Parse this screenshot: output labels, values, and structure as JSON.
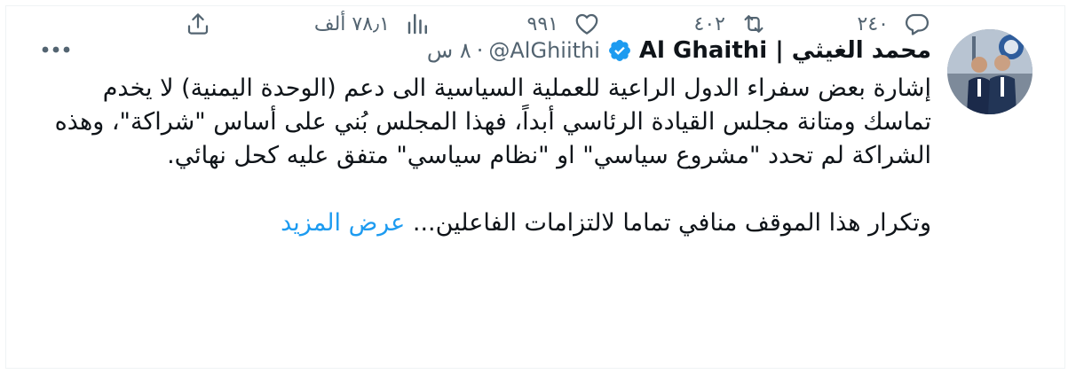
{
  "tweet": {
    "author": {
      "display_name": "محمد الغيثي | Al Ghaithi",
      "handle": "@AlGhiithi",
      "verified": true
    },
    "separator": "·",
    "time": "٨ س",
    "paragraphs": [
      "إشارة بعض سفراء الدول الراعية للعملية السياسية الى دعم (الوحدة اليمنية) لا يخدم تماسك ومتانة مجلس القيادة الرئاسي أبداً، فهذا المجلس بُني على أساس \"شراكة\"، وهذه الشراكة لم تحدد \"مشروع سياسي\" او \"نظام سياسي\" متفق عليه كحل نهائي.",
      "وتكرار هذا الموقف منافي تماما لالتزامات الفاعلين..."
    ],
    "show_more": "عرض المزيد",
    "stats": {
      "replies": "٢٤٠",
      "retweets": "٤٠٢",
      "likes": "٩٩١",
      "views": "٧٨٫١ ألف"
    }
  },
  "icons": {
    "more": "more-horizontal-icon",
    "verified": "verified-badge-icon",
    "reply": "reply-bubble-icon",
    "retweet": "retweet-icon",
    "like": "heart-icon",
    "views": "bar-chart-icon",
    "share": "share-upload-icon"
  },
  "colors": {
    "text": "#0f1419",
    "secondary": "#536471",
    "link": "#1d9bf0",
    "verified": "#1d9bf0",
    "border": "#eff3f4"
  }
}
